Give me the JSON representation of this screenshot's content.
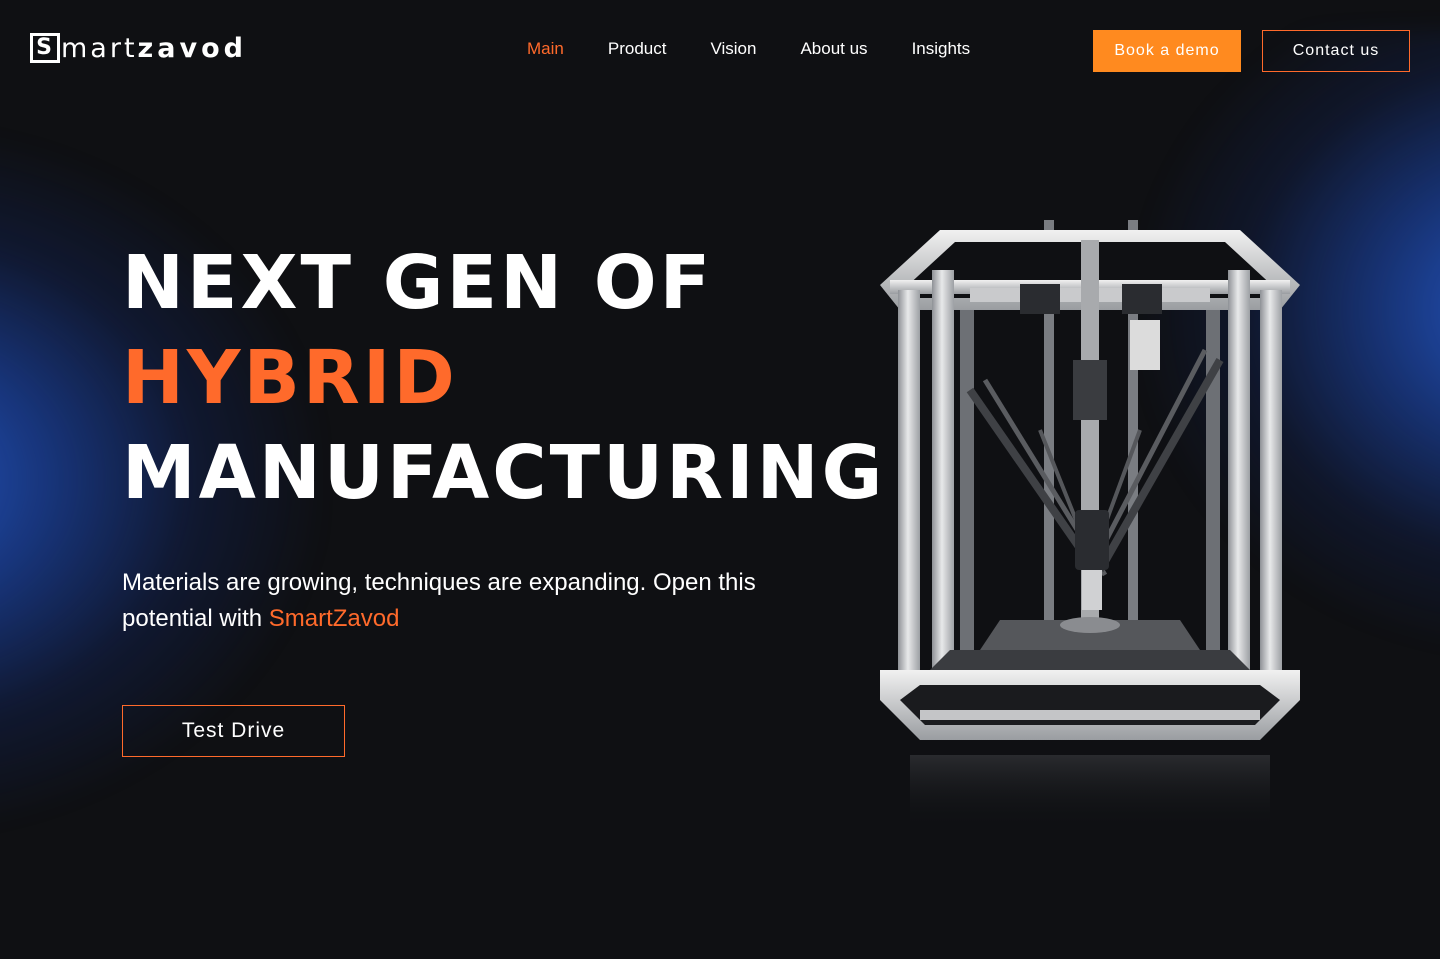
{
  "header": {
    "logo": {
      "mark": "S",
      "part1": "mart",
      "part2": "zavod"
    },
    "nav": [
      {
        "label": "Main",
        "active": true
      },
      {
        "label": "Product",
        "active": false
      },
      {
        "label": "Vision",
        "active": false
      },
      {
        "label": "About us",
        "active": false
      },
      {
        "label": "Insights",
        "active": false
      }
    ],
    "book_demo_label": "Book a demo",
    "contact_label": "Contact us"
  },
  "hero": {
    "title_line1": "NEXT GEN OF",
    "title_line2": "HYBRID",
    "title_line3": "MANUFACTURING",
    "subtitle_text": "Materials are growing, techniques are expanding. Open this potential with",
    "subtitle_brand": "SmartZavod",
    "cta_label": "Test Drive",
    "image_icon": "delta-3d-printer-illustration"
  },
  "colors": {
    "background": "#0f1013",
    "accent": "#ff6a2b",
    "demo_button": "#ff8a1f",
    "glow": "#2864e6"
  }
}
